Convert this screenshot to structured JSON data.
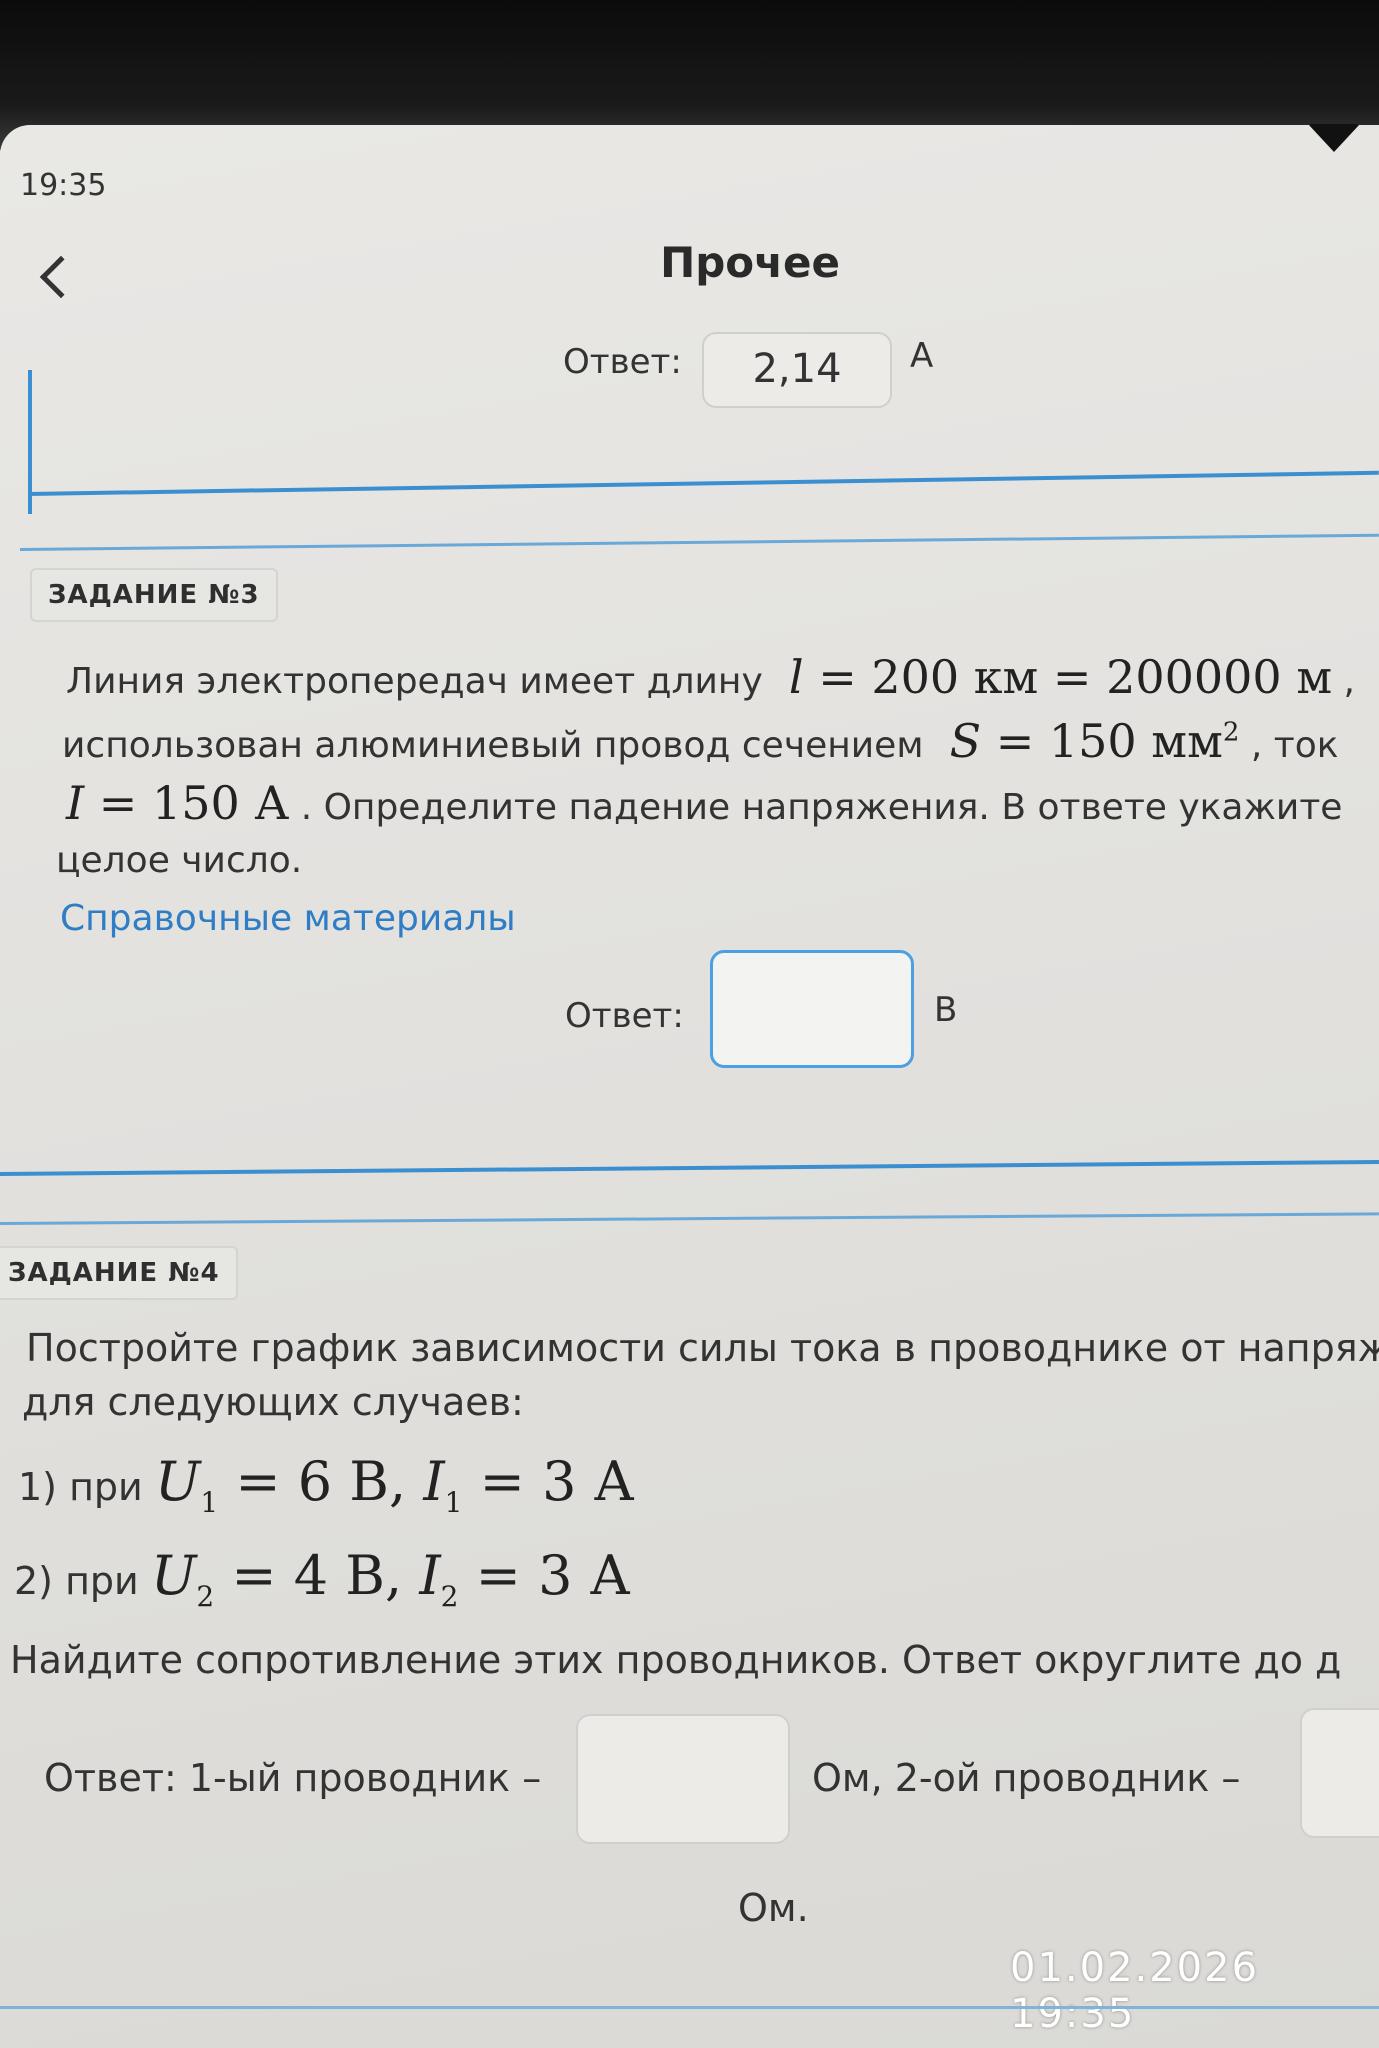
{
  "status": {
    "time": "19:35"
  },
  "header": {
    "title": "Прочее"
  },
  "task2": {
    "answer_label": "Ответ:",
    "answer_value": "2,14",
    "unit": "А"
  },
  "task3": {
    "tag": "ЗАДАНИЕ №3",
    "line1_text": "Линия электропередач имеет длину",
    "line1_math": {
      "var": "l",
      "eq1": "= 200 км = 200000 м",
      "tail": " ,"
    },
    "line2_text": "использован алюминиевый провод сечением",
    "line2_math": {
      "var": "S",
      "eq": "= 150 мм",
      "sup": "2",
      "tail": " , ток"
    },
    "line3_math": {
      "var": "I",
      "eq": "= 150 А"
    },
    "line3_text": ". Определите падение напряжения. В ответе укажите",
    "line4_text": "целое число.",
    "reference_link": "Справочные материалы",
    "answer_label": "Ответ:",
    "answer_value": "",
    "unit": "В"
  },
  "task4": {
    "tag": "ЗАДАНИЕ №4",
    "line1": "Постройте график зависимости силы тока в проводнике от напряж",
    "line2": "для следующих случаев:",
    "case1_prefix": "1) при",
    "case1_math": {
      "U": "U",
      "Usub": "1",
      "Uval": "= 6 В,",
      "I": "I",
      "Isub": "1",
      "Ival": "= 3 А"
    },
    "case2_prefix": "2) при",
    "case2_math": {
      "U": "U",
      "Usub": "2",
      "Uval": "= 4 В,",
      "I": "I",
      "Isub": "2",
      "Ival": "= 3 А"
    },
    "line_find": "Найдите сопротивление этих проводников. Ответ округлите до д",
    "answer_label1": "Ответ: 1-ый проводник –",
    "answer_value1": "",
    "answer_label2": "Ом, 2-ой проводник –",
    "answer_value2": "",
    "unit_last": "Ом."
  },
  "overlay": {
    "timestamp": "01.02.2026  19:35"
  }
}
